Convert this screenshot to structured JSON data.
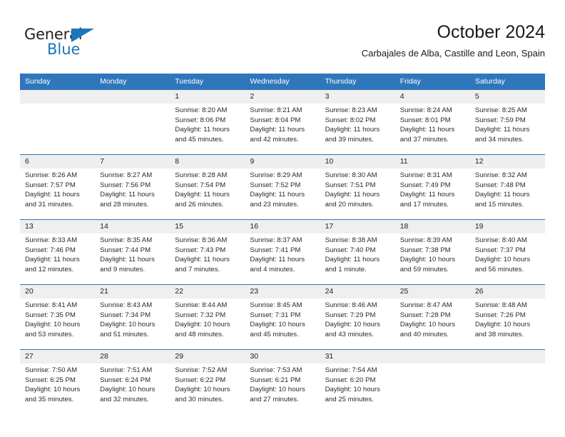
{
  "brand": {
    "name_part1": "General",
    "name_part2": "Blue",
    "triangle_color": "#1b75bb",
    "text_color": "#231f20"
  },
  "header": {
    "title": "October 2024",
    "subtitle": "Carbajales de Alba, Castille and Leon, Spain"
  },
  "theme": {
    "header_blue": "#3076bb",
    "datenum_band": "#efefef",
    "cell_bg": "#ffffff",
    "text": "#2a2a2a"
  },
  "weekdays": [
    "Sunday",
    "Monday",
    "Tuesday",
    "Wednesday",
    "Thursday",
    "Friday",
    "Saturday"
  ],
  "weeks": [
    [
      {
        "day": "",
        "sunrise": "",
        "sunset": "",
        "daylight": ""
      },
      {
        "day": "",
        "sunrise": "",
        "sunset": "",
        "daylight": ""
      },
      {
        "day": "1",
        "sunrise": "Sunrise: 8:20 AM",
        "sunset": "Sunset: 8:06 PM",
        "daylight": "Daylight: 11 hours and 45 minutes."
      },
      {
        "day": "2",
        "sunrise": "Sunrise: 8:21 AM",
        "sunset": "Sunset: 8:04 PM",
        "daylight": "Daylight: 11 hours and 42 minutes."
      },
      {
        "day": "3",
        "sunrise": "Sunrise: 8:23 AM",
        "sunset": "Sunset: 8:02 PM",
        "daylight": "Daylight: 11 hours and 39 minutes."
      },
      {
        "day": "4",
        "sunrise": "Sunrise: 8:24 AM",
        "sunset": "Sunset: 8:01 PM",
        "daylight": "Daylight: 11 hours and 37 minutes."
      },
      {
        "day": "5",
        "sunrise": "Sunrise: 8:25 AM",
        "sunset": "Sunset: 7:59 PM",
        "daylight": "Daylight: 11 hours and 34 minutes."
      }
    ],
    [
      {
        "day": "6",
        "sunrise": "Sunrise: 8:26 AM",
        "sunset": "Sunset: 7:57 PM",
        "daylight": "Daylight: 11 hours and 31 minutes."
      },
      {
        "day": "7",
        "sunrise": "Sunrise: 8:27 AM",
        "sunset": "Sunset: 7:56 PM",
        "daylight": "Daylight: 11 hours and 28 minutes."
      },
      {
        "day": "8",
        "sunrise": "Sunrise: 8:28 AM",
        "sunset": "Sunset: 7:54 PM",
        "daylight": "Daylight: 11 hours and 26 minutes."
      },
      {
        "day": "9",
        "sunrise": "Sunrise: 8:29 AM",
        "sunset": "Sunset: 7:52 PM",
        "daylight": "Daylight: 11 hours and 23 minutes."
      },
      {
        "day": "10",
        "sunrise": "Sunrise: 8:30 AM",
        "sunset": "Sunset: 7:51 PM",
        "daylight": "Daylight: 11 hours and 20 minutes."
      },
      {
        "day": "11",
        "sunrise": "Sunrise: 8:31 AM",
        "sunset": "Sunset: 7:49 PM",
        "daylight": "Daylight: 11 hours and 17 minutes."
      },
      {
        "day": "12",
        "sunrise": "Sunrise: 8:32 AM",
        "sunset": "Sunset: 7:48 PM",
        "daylight": "Daylight: 11 hours and 15 minutes."
      }
    ],
    [
      {
        "day": "13",
        "sunrise": "Sunrise: 8:33 AM",
        "sunset": "Sunset: 7:46 PM",
        "daylight": "Daylight: 11 hours and 12 minutes."
      },
      {
        "day": "14",
        "sunrise": "Sunrise: 8:35 AM",
        "sunset": "Sunset: 7:44 PM",
        "daylight": "Daylight: 11 hours and 9 minutes."
      },
      {
        "day": "15",
        "sunrise": "Sunrise: 8:36 AM",
        "sunset": "Sunset: 7:43 PM",
        "daylight": "Daylight: 11 hours and 7 minutes."
      },
      {
        "day": "16",
        "sunrise": "Sunrise: 8:37 AM",
        "sunset": "Sunset: 7:41 PM",
        "daylight": "Daylight: 11 hours and 4 minutes."
      },
      {
        "day": "17",
        "sunrise": "Sunrise: 8:38 AM",
        "sunset": "Sunset: 7:40 PM",
        "daylight": "Daylight: 11 hours and 1 minute."
      },
      {
        "day": "18",
        "sunrise": "Sunrise: 8:39 AM",
        "sunset": "Sunset: 7:38 PM",
        "daylight": "Daylight: 10 hours and 59 minutes."
      },
      {
        "day": "19",
        "sunrise": "Sunrise: 8:40 AM",
        "sunset": "Sunset: 7:37 PM",
        "daylight": "Daylight: 10 hours and 56 minutes."
      }
    ],
    [
      {
        "day": "20",
        "sunrise": "Sunrise: 8:41 AM",
        "sunset": "Sunset: 7:35 PM",
        "daylight": "Daylight: 10 hours and 53 minutes."
      },
      {
        "day": "21",
        "sunrise": "Sunrise: 8:43 AM",
        "sunset": "Sunset: 7:34 PM",
        "daylight": "Daylight: 10 hours and 51 minutes."
      },
      {
        "day": "22",
        "sunrise": "Sunrise: 8:44 AM",
        "sunset": "Sunset: 7:32 PM",
        "daylight": "Daylight: 10 hours and 48 minutes."
      },
      {
        "day": "23",
        "sunrise": "Sunrise: 8:45 AM",
        "sunset": "Sunset: 7:31 PM",
        "daylight": "Daylight: 10 hours and 45 minutes."
      },
      {
        "day": "24",
        "sunrise": "Sunrise: 8:46 AM",
        "sunset": "Sunset: 7:29 PM",
        "daylight": "Daylight: 10 hours and 43 minutes."
      },
      {
        "day": "25",
        "sunrise": "Sunrise: 8:47 AM",
        "sunset": "Sunset: 7:28 PM",
        "daylight": "Daylight: 10 hours and 40 minutes."
      },
      {
        "day": "26",
        "sunrise": "Sunrise: 8:48 AM",
        "sunset": "Sunset: 7:26 PM",
        "daylight": "Daylight: 10 hours and 38 minutes."
      }
    ],
    [
      {
        "day": "27",
        "sunrise": "Sunrise: 7:50 AM",
        "sunset": "Sunset: 6:25 PM",
        "daylight": "Daylight: 10 hours and 35 minutes."
      },
      {
        "day": "28",
        "sunrise": "Sunrise: 7:51 AM",
        "sunset": "Sunset: 6:24 PM",
        "daylight": "Daylight: 10 hours and 32 minutes."
      },
      {
        "day": "29",
        "sunrise": "Sunrise: 7:52 AM",
        "sunset": "Sunset: 6:22 PM",
        "daylight": "Daylight: 10 hours and 30 minutes."
      },
      {
        "day": "30",
        "sunrise": "Sunrise: 7:53 AM",
        "sunset": "Sunset: 6:21 PM",
        "daylight": "Daylight: 10 hours and 27 minutes."
      },
      {
        "day": "31",
        "sunrise": "Sunrise: 7:54 AM",
        "sunset": "Sunset: 6:20 PM",
        "daylight": "Daylight: 10 hours and 25 minutes."
      },
      {
        "day": "",
        "sunrise": "",
        "sunset": "",
        "daylight": ""
      },
      {
        "day": "",
        "sunrise": "",
        "sunset": "",
        "daylight": ""
      }
    ]
  ]
}
